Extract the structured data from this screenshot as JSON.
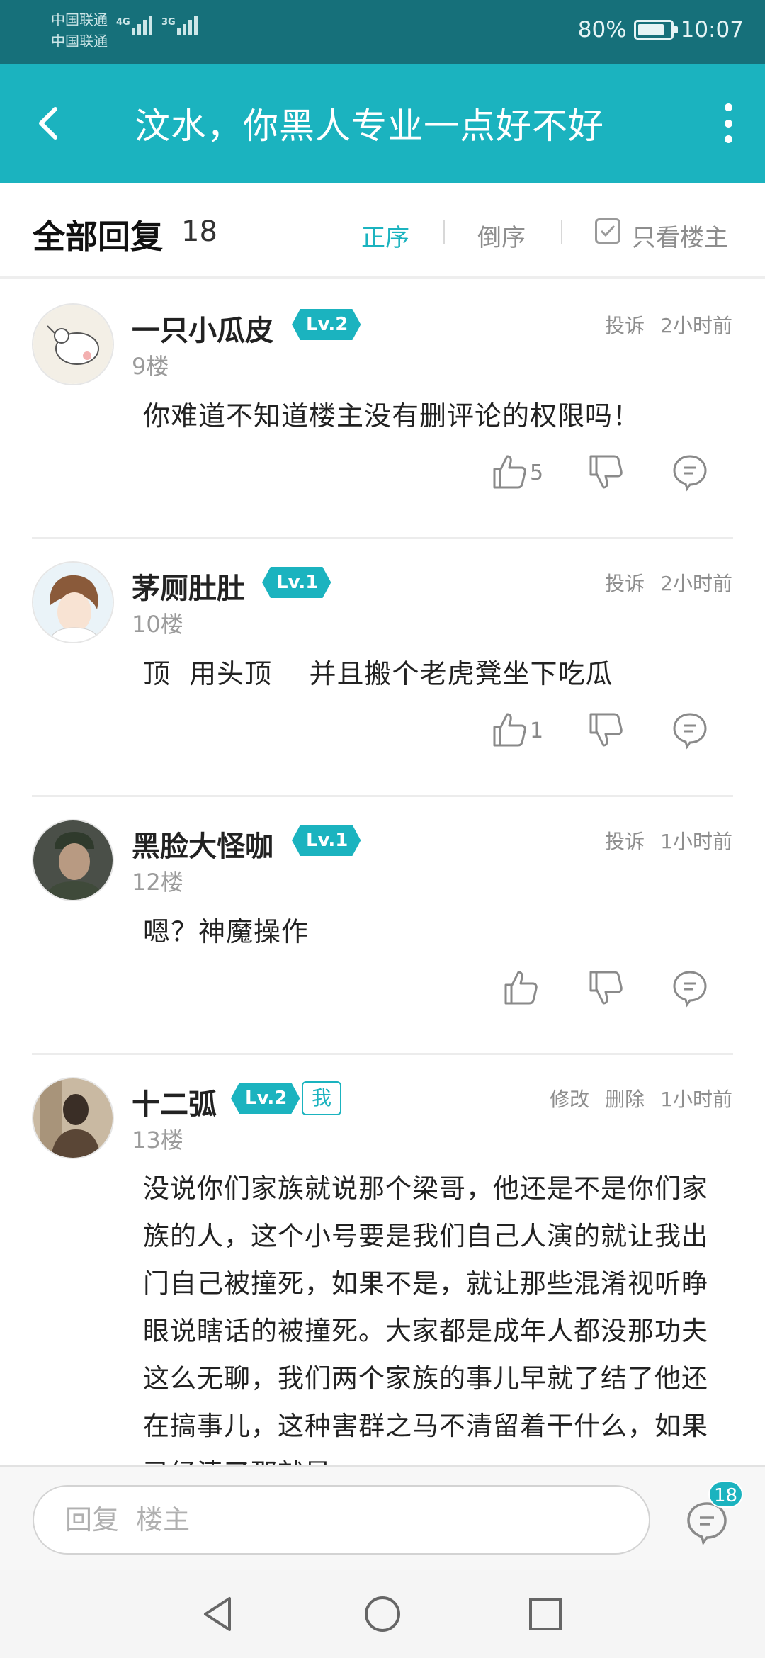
{
  "status_bar": {
    "carrier1": "中国联通",
    "carrier2": "中国联通",
    "net1": "4G",
    "net2": "3G",
    "battery": "80%",
    "time": "10:07"
  },
  "header": {
    "title": "汶水，你黑人专业一点好不好",
    "back_icon": "back-arrow-icon",
    "more_icon": "more-vertical-icon"
  },
  "filter": {
    "all_label": "全部回复",
    "count": "18",
    "sort_asc": "正序",
    "sort_desc": "倒序",
    "only_op": "只看楼主",
    "active_color": "#1bb3bf"
  },
  "comments": [
    {
      "name": "一只小瓜皮",
      "level": "Lv.2",
      "floor": "9楼",
      "report": "投诉",
      "time": "2小时前",
      "content": "你难道不知道楼主没有删评论的权限吗！",
      "likes": "5"
    },
    {
      "name": "茅厕肚肚",
      "level": "Lv.1",
      "floor": "10楼",
      "report": "投诉",
      "time": "2小时前",
      "content": "顶  用头顶    并且搬个老虎凳坐下吃瓜",
      "likes": "1"
    },
    {
      "name": "黑脸大怪咖",
      "level": "Lv.1",
      "floor": "12楼",
      "report": "投诉",
      "time": "1小时前",
      "content": "嗯？神魔操作",
      "likes": ""
    },
    {
      "name": "十二弧",
      "level": "Lv.2",
      "me_badge": "我",
      "floor": "13楼",
      "edit": "修改",
      "delete": "删除",
      "time": "1小时前",
      "content": "没说你们家族就说那个梁哥，他还是不是你们家族的人，这个小号要是我们自己人演的就让我出门自己被撞死，如果不是，就让那些混淆视听睁眼说瞎话的被撞死。大家都是成年人都没那功夫这么无聊，我们两个家族的事儿早就了结了他还在搞事儿，这种害群之马不清留着干什么，如果已经清了那就是"
    }
  ],
  "reply_bar": {
    "placeholder": "回复  楼主",
    "comment_count": "18"
  },
  "nav_bar": {
    "back": "nav-back-icon",
    "home": "nav-home-icon",
    "recent": "nav-recent-icon"
  }
}
